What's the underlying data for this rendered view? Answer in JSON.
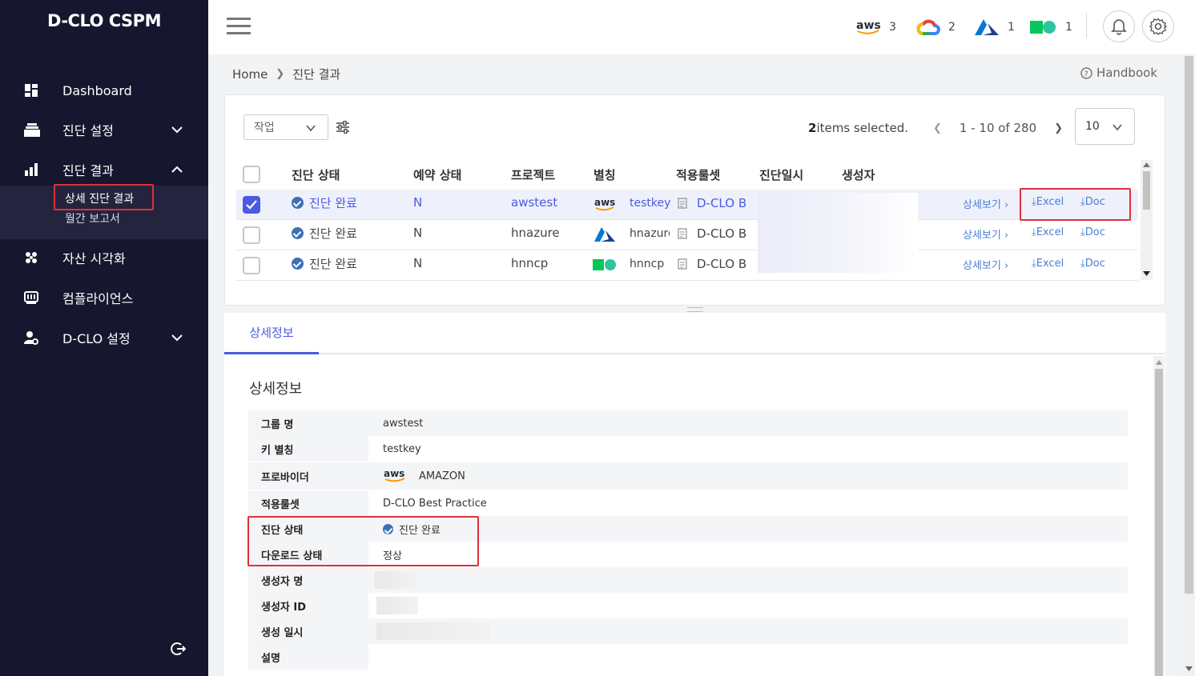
{
  "brand": "D-CLO CSPM",
  "nav": {
    "dashboard": "Dashboard",
    "scan_settings": "진단 설정",
    "scan_results": "진단 결과",
    "sub_detail": "상세 진단 결과",
    "sub_monthly": "월간 보고서",
    "asset_viz": "자산 시각화",
    "compliance": "컴플라이언스",
    "dclo_settings": "D-CLO 설정"
  },
  "header": {
    "clouds": [
      {
        "name": "aws",
        "icon": "aws-icon",
        "count": "3"
      },
      {
        "name": "gcp",
        "icon": "gcp-icon",
        "count": "2"
      },
      {
        "name": "azure",
        "icon": "azure-icon",
        "count": "1"
      },
      {
        "name": "ncp",
        "icon": "ncp-icon",
        "count": "1"
      }
    ]
  },
  "breadcrumb": {
    "home": "Home",
    "current": "진단 결과"
  },
  "handbook": "Handbook",
  "toolbar": {
    "action_select": "작업",
    "selected_count": "2",
    "selected_suffix": "items selected.",
    "range": "1 - 10 of 280",
    "page_size": "10"
  },
  "table": {
    "headers": [
      "진단 상태",
      "예약 상태",
      "프로젝트",
      "별칭",
      "적용룰셋",
      "진단일시",
      "생성자"
    ],
    "rows": [
      {
        "status": "진단 완료",
        "reserve": "N",
        "project": "awstest",
        "provider": "aws",
        "alias": "testkey",
        "ruleset": "D-CLO B",
        "detail": "상세보기",
        "excel": "Excel",
        "doc": "Doc",
        "checked": true
      },
      {
        "status": "진단 완료",
        "reserve": "N",
        "project": "hnazure",
        "provider": "azure",
        "alias": "hnazure",
        "ruleset": "D-CLO B",
        "detail": "상세보기",
        "excel": "Excel",
        "doc": "Doc",
        "checked": false
      },
      {
        "status": "진단 완료",
        "reserve": "N",
        "project": "hnncp",
        "provider": "ncp",
        "alias": "hnncp",
        "ruleset": "D-CLO B",
        "detail": "상세보기",
        "excel": "Excel",
        "doc": "Doc",
        "checked": false
      }
    ]
  },
  "tabs": {
    "active": "상세정보"
  },
  "detail": {
    "title": "상세정보",
    "rows": [
      {
        "label": "그룹 명",
        "value": "awstest"
      },
      {
        "label": "키 별칭",
        "value": "testkey"
      },
      {
        "label": "프로바이더",
        "value": "AMAZON"
      },
      {
        "label": "적용룰셋",
        "value": "D-CLO Best Practice"
      },
      {
        "label": "진단 상태",
        "value": "진단 완료"
      },
      {
        "label": "다운로드 상태",
        "value": "정상"
      },
      {
        "label": "생성자 명",
        "value": ""
      },
      {
        "label": "생성자 ID",
        "value": ""
      },
      {
        "label": "생성 일시",
        "value": ""
      },
      {
        "label": "설명",
        "value": ""
      }
    ]
  },
  "colors": {
    "sidebar": "#16162e",
    "accent": "#4a5be0",
    "highlight": "#e0303a"
  }
}
